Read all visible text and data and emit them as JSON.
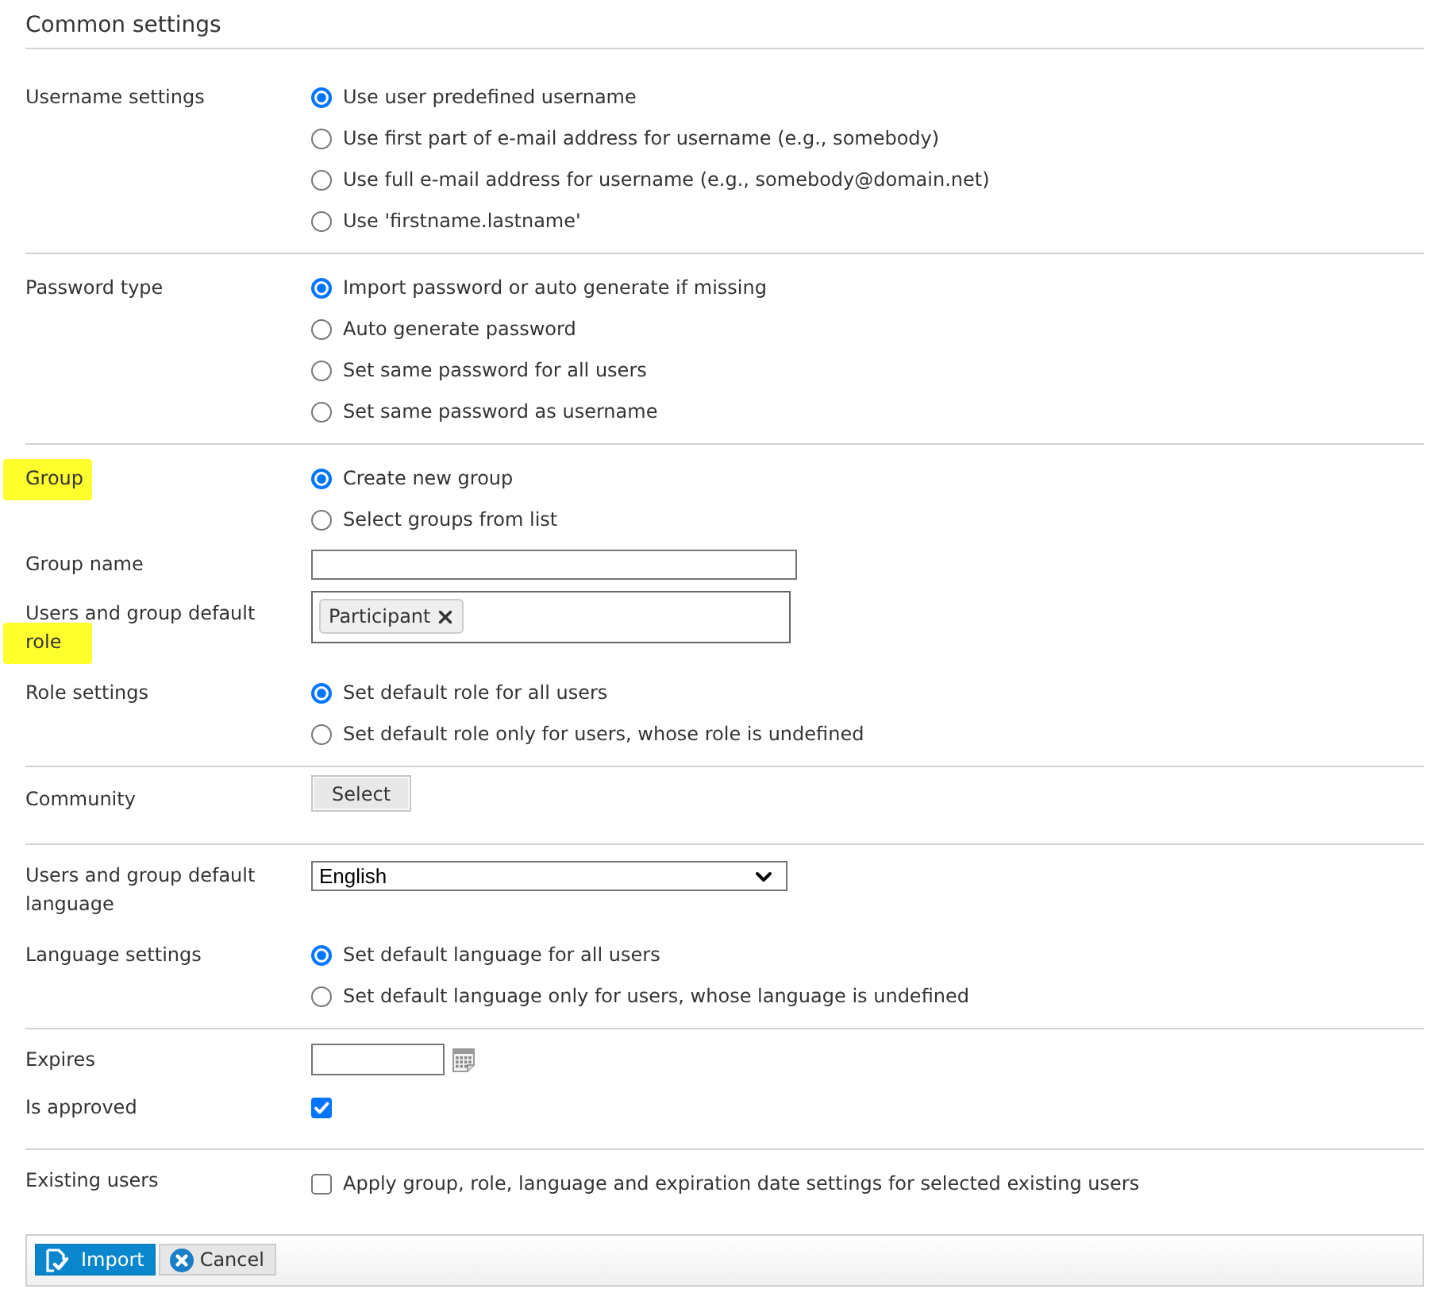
{
  "title": "Common settings",
  "sections": [
    {
      "rows": [
        {
          "kind": "radio",
          "label": "Username settings",
          "options": [
            {
              "label": "Use user predefined username",
              "selected": true
            },
            {
              "label": "Use first part of e-mail address for username (e.g., somebody)",
              "selected": false
            },
            {
              "label": "Use full e-mail address for username (e.g., somebody@domain.net)",
              "selected": false
            },
            {
              "label": "Use 'firstname.lastname'",
              "selected": false
            }
          ]
        }
      ]
    },
    {
      "rows": [
        {
          "kind": "radio",
          "label": "Password type",
          "options": [
            {
              "label": "Import password or auto generate if missing",
              "selected": true
            },
            {
              "label": "Auto generate password",
              "selected": false
            },
            {
              "label": "Set same password for all users",
              "selected": false
            },
            {
              "label": "Set same password as username",
              "selected": false
            }
          ]
        }
      ]
    },
    {
      "rows": [
        {
          "kind": "radio",
          "label": "Group",
          "highlighted": true,
          "options": [
            {
              "label": "Create new group",
              "selected": true
            },
            {
              "label": "Select groups from list",
              "selected": false
            }
          ]
        },
        {
          "kind": "text",
          "label": "Group name"
        },
        {
          "kind": "tags",
          "label": "Users and group default role",
          "highlighted": true,
          "tags": [
            {
              "label": "Participant"
            }
          ]
        },
        {
          "kind": "radio",
          "label": "Role settings",
          "options": [
            {
              "label": "Set default role for all users",
              "selected": true
            },
            {
              "label": "Set default role only for users, whose role is undefined",
              "selected": false
            }
          ]
        }
      ]
    },
    {
      "rows": [
        {
          "kind": "button",
          "label": "Community",
          "button": "Select"
        }
      ]
    },
    {
      "rows": [
        {
          "kind": "select",
          "label": "Users and group default language",
          "value": "English"
        },
        {
          "kind": "radio",
          "label": "Language settings",
          "options": [
            {
              "label": "Set default language for all users",
              "selected": true
            },
            {
              "label": "Set default language only for users, whose language is undefined",
              "selected": false
            }
          ]
        }
      ]
    },
    {
      "rows": [
        {
          "kind": "date",
          "label": "Expires"
        },
        {
          "kind": "checkbox",
          "label": "Is approved",
          "checked": true
        }
      ]
    },
    {
      "rows": [
        {
          "kind": "checkbox",
          "label": "Existing users",
          "checked": false,
          "text": "Apply group, role, language and expiration date settings for selected existing users"
        }
      ]
    }
  ],
  "actions": [
    {
      "kind": "primary",
      "label": "Import"
    },
    {
      "kind": "secondary",
      "label": "Cancel"
    }
  ]
}
